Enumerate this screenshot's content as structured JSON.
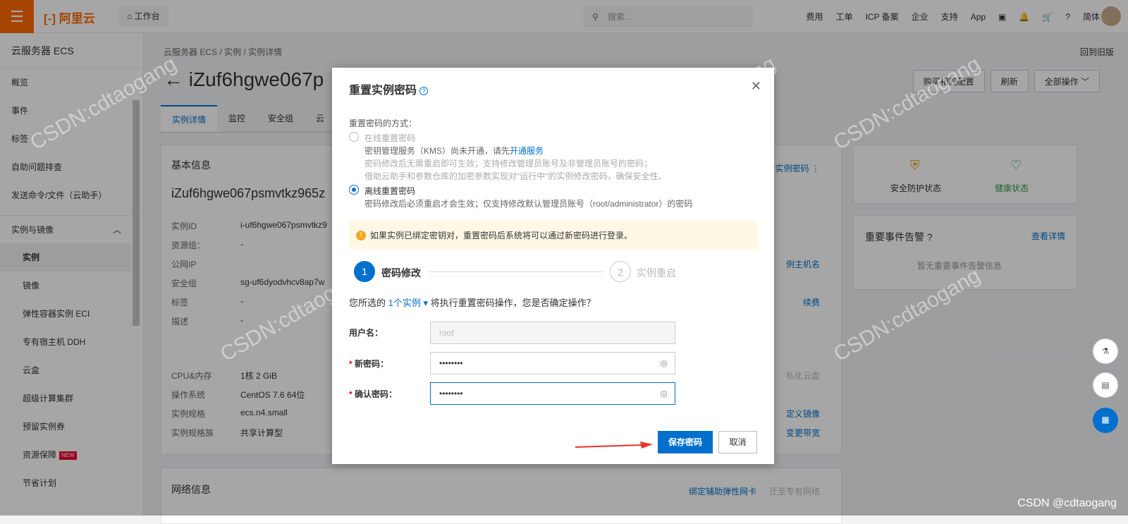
{
  "topbar": {
    "logo": "阿里云",
    "workbench": "工作台",
    "search_placeholder": "搜索...",
    "nav": [
      "费用",
      "工单",
      "ICP 备案",
      "企业",
      "支持",
      "App"
    ],
    "lang": "简体"
  },
  "sidebar": {
    "title": "云服务器 ECS",
    "items": [
      "概览",
      "事件",
      "标签",
      "自助问题排查",
      "发送命令/文件（云助手）"
    ],
    "group": "实例与镜像",
    "sub_items": [
      "实例",
      "镜像",
      "弹性容器实例 ECI",
      "专有宿主机 DDH",
      "云盒",
      "超级计算集群",
      "预留实例券",
      "资源保障",
      "节省计划"
    ],
    "new_badge": "NEW"
  },
  "main": {
    "breadcrumb": "云服务器 ECS / 实例 / 实例详情",
    "back_old": "回到旧版",
    "title": "iZuf6hgwe067p",
    "buttons": [
      "购买相同配置",
      "刷新",
      "全部操作"
    ],
    "tabs": [
      "实例详情",
      "监控",
      "安全组",
      "云"
    ],
    "basic_title": "基本信息",
    "instance_name": "iZuf6hgwe067psmvtkz965z",
    "reset_link": "重置实例密码",
    "rows": [
      {
        "k": "实例ID",
        "v": "i-uf6hgwe067psmvtkz9"
      },
      {
        "k": "资源组：",
        "v": "-"
      },
      {
        "k": "公网IP",
        "v": ""
      },
      {
        "k": "安全组",
        "v": "sg-uf6dyodvhcv8ap7w"
      },
      {
        "k": "标签",
        "v": "-"
      },
      {
        "k": "描述",
        "v": "-"
      }
    ],
    "rows2": [
      {
        "k": "CPU&内存",
        "v": "1核 2 GiB"
      },
      {
        "k": "操作系统",
        "v": "CentOS 7.6 64位"
      },
      {
        "k": "实例规格",
        "v": "ecs.n4.small"
      },
      {
        "k": "实例规格族",
        "v": "共享计算型"
      }
    ],
    "right_links": [
      "例主机名",
      "续费",
      "私化云盘",
      "定义镜像",
      "变更带宽"
    ],
    "net_title": "网络信息",
    "net_links": [
      "绑定辅助弹性网卡",
      "迁至专有网络"
    ],
    "status": {
      "security": "安全防护状态",
      "health": "健康状态"
    },
    "events": {
      "title": "重要事件告警",
      "link": "查看详情",
      "empty": "暂无重要事件告警信息"
    }
  },
  "dialog": {
    "title": "重置实例密码",
    "method_label": "重置密码的方式：",
    "online": {
      "label": "在线重置密码",
      "line1_pre": "密钥管理服务（KMS）尚未开通，请先",
      "line1_link": "开通服务",
      "line2": "密码修改后无需重启即可生效；支持修改管理员账号及非管理员账号的密码；",
      "line3": "借助云助手和参数仓库的加密参数实现对\"运行中\"的实例修改密码，确保安全性。"
    },
    "offline": {
      "label": "离线重置密码",
      "desc": "密码修改后必须重启才会生效；仅支持修改默认管理员账号（root/administrator）的密码"
    },
    "notice": "如果实例已绑定密钥对，重置密码后系统将可以通过新密码进行登录。",
    "steps": [
      {
        "num": "1",
        "label": "密码修改"
      },
      {
        "num": "2",
        "label": "实例重启"
      }
    ],
    "confirm_pre": "您所选的",
    "confirm_link": "1个实例",
    "confirm_post": "将执行重置密码操作，您是否确定操作？",
    "username_label": "用户名：",
    "username_value": "root",
    "newpwd_label": "新密码：",
    "newpwd_value": "••••••••",
    "confirm_label": "确认密码：",
    "confirm_value": "••••••••",
    "save": "保存密码",
    "cancel": "取消"
  },
  "watermark": "CSDN:cdtaogang",
  "footer_mark": "CSDN @cdtaogang"
}
